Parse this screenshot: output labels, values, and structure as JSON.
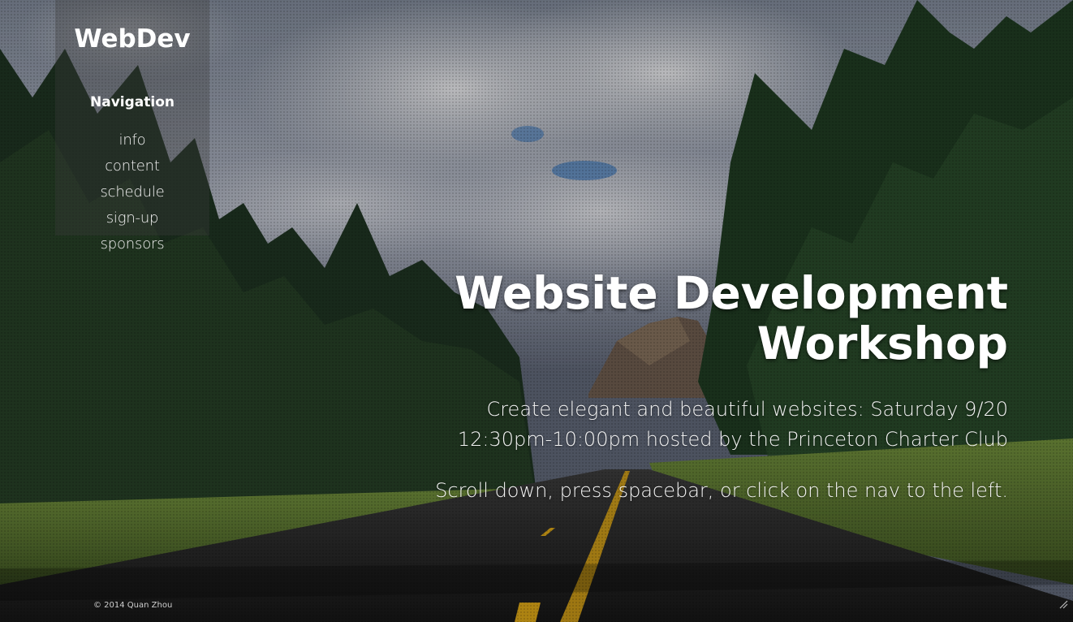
{
  "sidebar": {
    "logo": "WebDev",
    "nav_heading": "Navigation",
    "items": [
      {
        "label": "info"
      },
      {
        "label": "content"
      },
      {
        "label": "schedule"
      },
      {
        "label": "sign-up"
      },
      {
        "label": "sponsors"
      }
    ]
  },
  "hero": {
    "title_line1": "Website Development",
    "title_line2": "Workshop",
    "subtitle_line1": "Create elegant and beautiful websites: Saturday 9/20",
    "subtitle_line2": "12:30pm-10:00pm hosted by the Princeton Charter Club",
    "hint": "Scroll down, press spacebar, or click on the nav to the left."
  },
  "footer": {
    "copyright": "© 2014 Quan Zhou"
  },
  "colors": {
    "text": "#ffffff",
    "sidebar_bg": "rgba(60,60,60,0.35)",
    "road_line": "#d4a017"
  },
  "icons": {
    "resize": "resize-grip-icon"
  }
}
